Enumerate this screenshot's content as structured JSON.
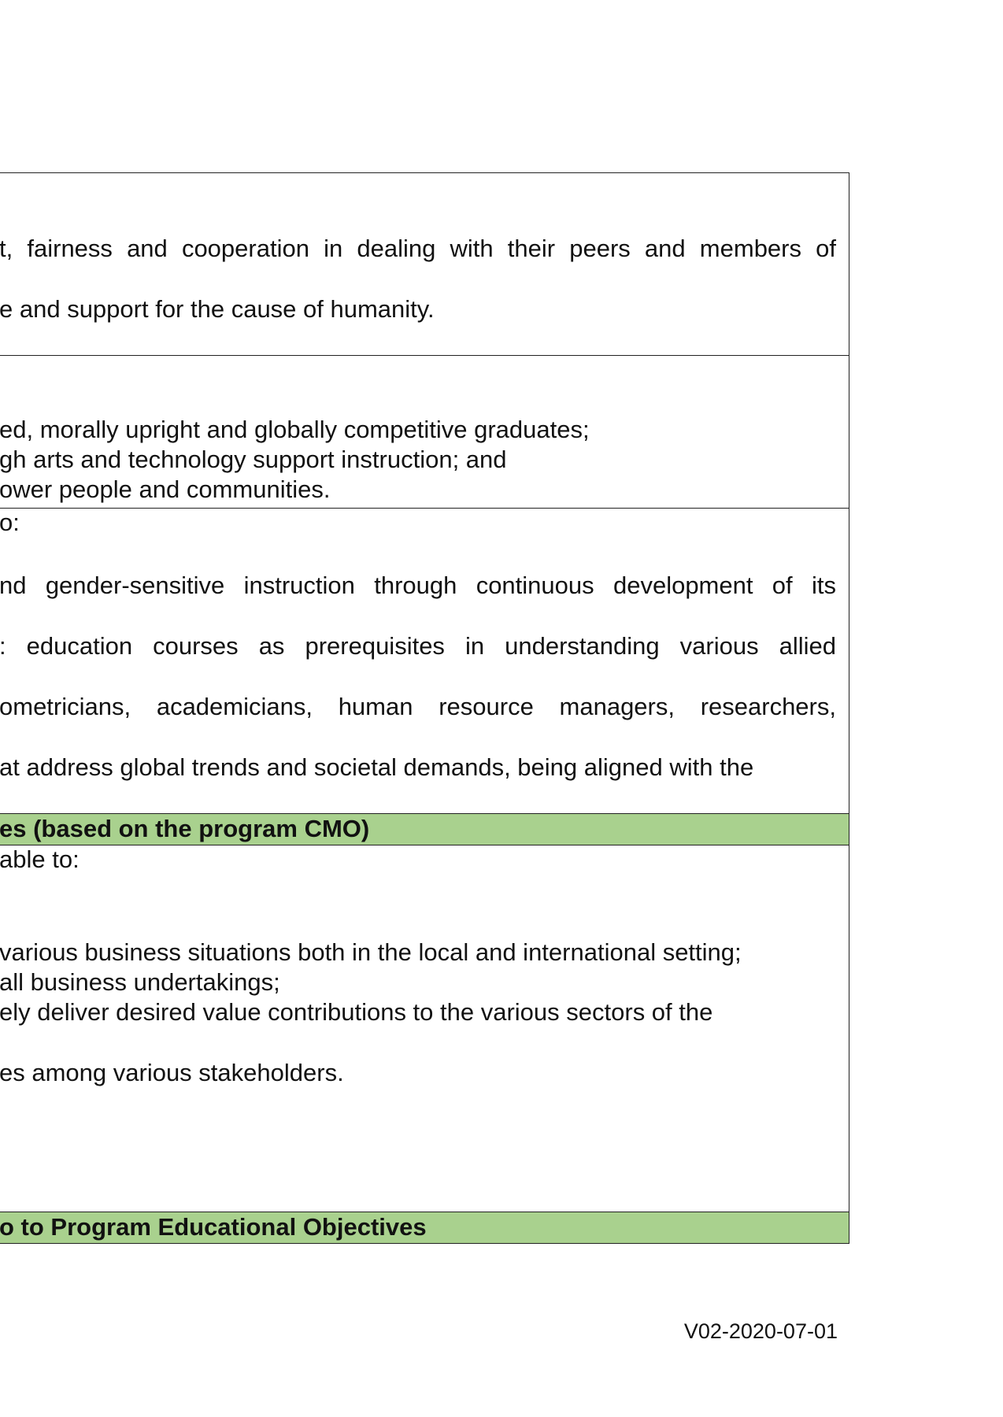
{
  "section1": {
    "line1_words": [
      "t,",
      "fairness",
      "and",
      "cooperation",
      "in",
      "dealing",
      "with",
      "their",
      "peers",
      "and",
      "members",
      "of"
    ],
    "line2": "e and support for the cause of humanity."
  },
  "section2": {
    "line1": "ed, morally upright and globally competitive graduates;",
    "line2": "gh arts and technology support instruction; and",
    "line3": "ower people and communities."
  },
  "section3": {
    "intro": "o:",
    "line1_words": [
      "nd",
      "gender-sensitive",
      "instruction",
      "through",
      "continuous",
      "development",
      "of",
      "its"
    ],
    "line2_words": [
      ":",
      "education",
      "courses",
      "as",
      "prerequisites",
      "in",
      "understanding",
      "various",
      "allied"
    ],
    "line3_words": [
      "ometricians,",
      "academicians,",
      "human",
      "resource",
      "managers,",
      "researchers,"
    ],
    "line4": "at address global trends and societal demands, being aligned with the"
  },
  "header1": "es (based on the program CMO)",
  "section4": {
    "intro": " able to:",
    "line1": "various business situations both in the local and international setting;",
    "line2": " all business undertakings;",
    "line3": "ely deliver desired value contributions to the various sectors of the",
    "line4": "es among various stakeholders."
  },
  "header2": "o to Program Educational Objectives",
  "footer": "V02-2020-07-01",
  "colors": {
    "header_fill": "#a9d18e",
    "border": "#222222"
  }
}
